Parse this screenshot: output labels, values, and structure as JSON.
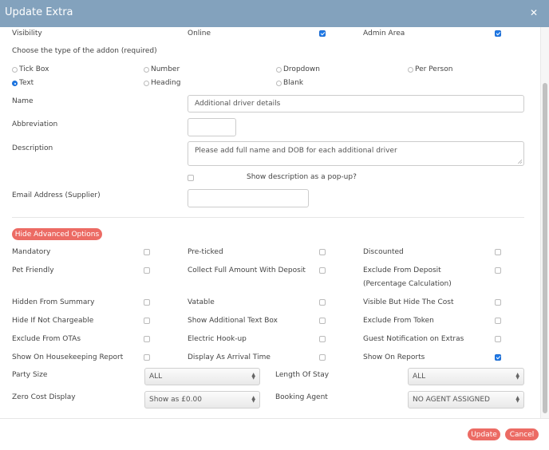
{
  "modal": {
    "title": "Update Extra",
    "close_icon": "close-icon"
  },
  "visibility": {
    "label": "Visibility",
    "online_label": "Online",
    "online_checked": true,
    "admin_label": "Admin Area",
    "admin_checked": true
  },
  "addon_type": {
    "label": "Choose the type of the addon (required)",
    "options": [
      {
        "label": "Tick Box",
        "selected": false
      },
      {
        "label": "Number",
        "selected": false
      },
      {
        "label": "Dropdown",
        "selected": false
      },
      {
        "label": "Per Person",
        "selected": false
      },
      {
        "label": "Text",
        "selected": true
      },
      {
        "label": "Heading",
        "selected": false
      },
      {
        "label": "Blank",
        "selected": false
      }
    ]
  },
  "fields": {
    "name_label": "Name",
    "name_value": "Additional driver details",
    "abbreviation_label": "Abbreviation",
    "abbreviation_value": "",
    "description_label": "Description",
    "description_value": "Please add full name and DOB for each additional driver",
    "popup_label": "Show description as a pop-up?",
    "popup_checked": false,
    "email_label": "Email Address (Supplier)",
    "email_value": ""
  },
  "advanced": {
    "toggle_label": "Hide Advanced Options",
    "options": [
      {
        "label": "Mandatory",
        "checked": false
      },
      {
        "label": "Pre-ticked",
        "checked": false
      },
      {
        "label": "Discounted",
        "checked": false
      },
      {
        "label": "Pet Friendly",
        "checked": false
      },
      {
        "label": "Collect Full Amount With Deposit",
        "checked": false
      },
      {
        "label": "Exclude From Deposit",
        "label2": "(Percentage Calculation)",
        "checked": false
      },
      {
        "label": "Hidden From Summary",
        "checked": false
      },
      {
        "label": "Vatable",
        "checked": false
      },
      {
        "label": "Visible But Hide The Cost",
        "checked": false
      },
      {
        "label": "Hide If Not Chargeable",
        "checked": false
      },
      {
        "label": "Show Additional Text Box",
        "checked": false
      },
      {
        "label": "Exclude From Token",
        "checked": false
      },
      {
        "label": "Exclude From OTAs",
        "checked": false
      },
      {
        "label": "Electric Hook-up",
        "checked": false
      },
      {
        "label": "Guest Notification on Extras",
        "checked": false
      },
      {
        "label": "Show On Housekeeping Report",
        "checked": false
      },
      {
        "label": "Display As Arrival Time",
        "checked": false
      },
      {
        "label": "Show On Reports",
        "checked": true
      }
    ],
    "selects": {
      "party_size_label": "Party Size",
      "party_size_value": "ALL",
      "length_of_stay_label": "Length Of Stay",
      "length_of_stay_value": "ALL",
      "zero_cost_label": "Zero Cost Display",
      "zero_cost_value": "Show as £0.00",
      "booking_agent_label": "Booking Agent",
      "booking_agent_value": "NO AGENT ASSIGNED"
    }
  },
  "footer": {
    "update_label": "Update",
    "cancel_label": "Cancel"
  },
  "colors": {
    "header": "#83a2bd",
    "accent_button": "#ec6b64",
    "checkbox_checked": "#1f7ae8"
  }
}
